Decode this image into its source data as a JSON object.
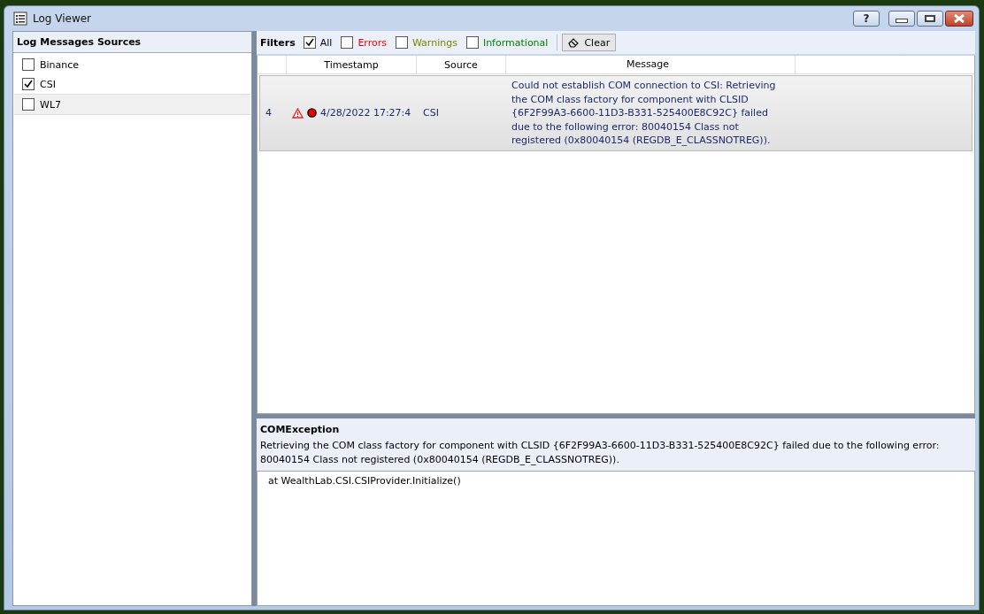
{
  "window": {
    "title": "Log Viewer",
    "help_label": "?"
  },
  "sources": {
    "title": "Log Messages Sources",
    "items": [
      {
        "label": "Binance",
        "checked": false,
        "selected": false
      },
      {
        "label": "CSI",
        "checked": true,
        "selected": false
      },
      {
        "label": "WL7",
        "checked": false,
        "selected": true
      }
    ]
  },
  "filters": {
    "label": "Filters",
    "items": [
      {
        "label": "All",
        "checked": true,
        "color": "#000000"
      },
      {
        "label": "Errors",
        "checked": false,
        "color": "#ff0000"
      },
      {
        "label": "Warnings",
        "checked": false,
        "color": "#808000"
      },
      {
        "label": "Informational",
        "checked": false,
        "color": "#008000"
      }
    ],
    "clear_label": "Clear"
  },
  "table": {
    "columns": [
      "Timestamp",
      "Source",
      "Message"
    ],
    "rows": [
      {
        "id": "4",
        "timestamp": "4/28/2022 17:27:4",
        "source": "CSI",
        "message": "Could not establish COM connection to CSI: Retrieving the COM class factory for component with CLSID {6F2F99A3-6600-11D3-B331-525400E8C92C} failed due to the following error: 80040154 Class not registered (0x80040154 (REGDB_E_CLASSNOTREG)).",
        "selected": true
      }
    ]
  },
  "details": {
    "title": "COMException",
    "message": "Retrieving the COM class factory for component with CLSID {6F2F99A3-6600-11D3-B331-525400E8C92C} failed due to the following error: 80040154 Class not registered (0x80040154 (REGDB_E_CLASSNOTREG)).",
    "stack_trace": "at WealthLab.CSI.CSIProvider.Initialize()"
  }
}
